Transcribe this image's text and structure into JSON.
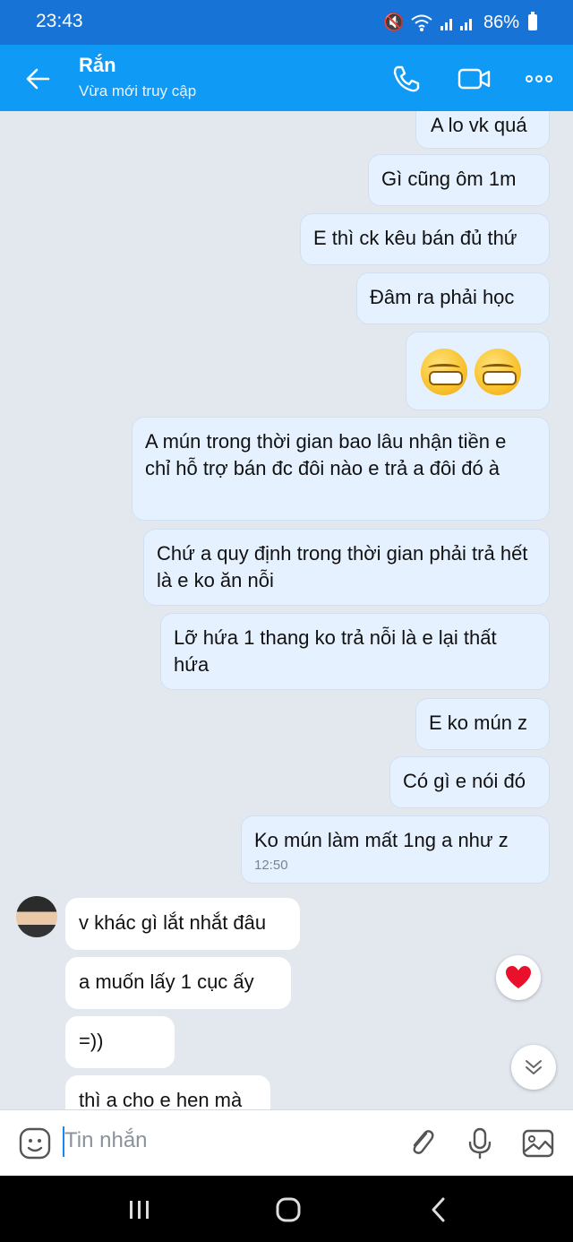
{
  "status": {
    "time": "23:43",
    "battery": "86%"
  },
  "header": {
    "title": "Rắn",
    "subtitle": "Vừa mới truy cập"
  },
  "messages": [
    {
      "text": "A lo vk quá"
    },
    {
      "text": "Gì cũng ôm 1m"
    },
    {
      "text": "E thì ck kêu bán đủ thứ"
    },
    {
      "text": "Đâm ra phải học"
    },
    {
      "emoji": "grinning-face"
    },
    {
      "text": "A mún trong thời gian bao lâu nhận tiền e chỉ hỗ trợ bán đc đôi nào e trả a đôi đó à"
    },
    {
      "text": "Chứ a quy định trong thời gian phải trả hết là e ko ăn nỗi"
    },
    {
      "text": "Lỡ hứa 1 thang ko trả nỗi là e lại thất hứa"
    },
    {
      "text": "E ko mún z"
    },
    {
      "text": "Có gì e nói đó"
    },
    {
      "text": "Ko mún làm mất 1ng a như z",
      "time": "12:50"
    },
    {
      "text": "v khác gì lắt nhắt đâu"
    },
    {
      "text": "a muốn lấy 1 cục ấy"
    },
    {
      "text": "=))"
    },
    {
      "text": "thì a cho e hen mà"
    }
  ],
  "input": {
    "placeholder": "Tin nhắn"
  },
  "colors": {
    "header": "#0f9af6",
    "status_bar": "#1873d7",
    "outgoing_bubble": "#e5f1ff",
    "incoming_bubble": "#ffffff",
    "background": "#e3e8ef"
  }
}
